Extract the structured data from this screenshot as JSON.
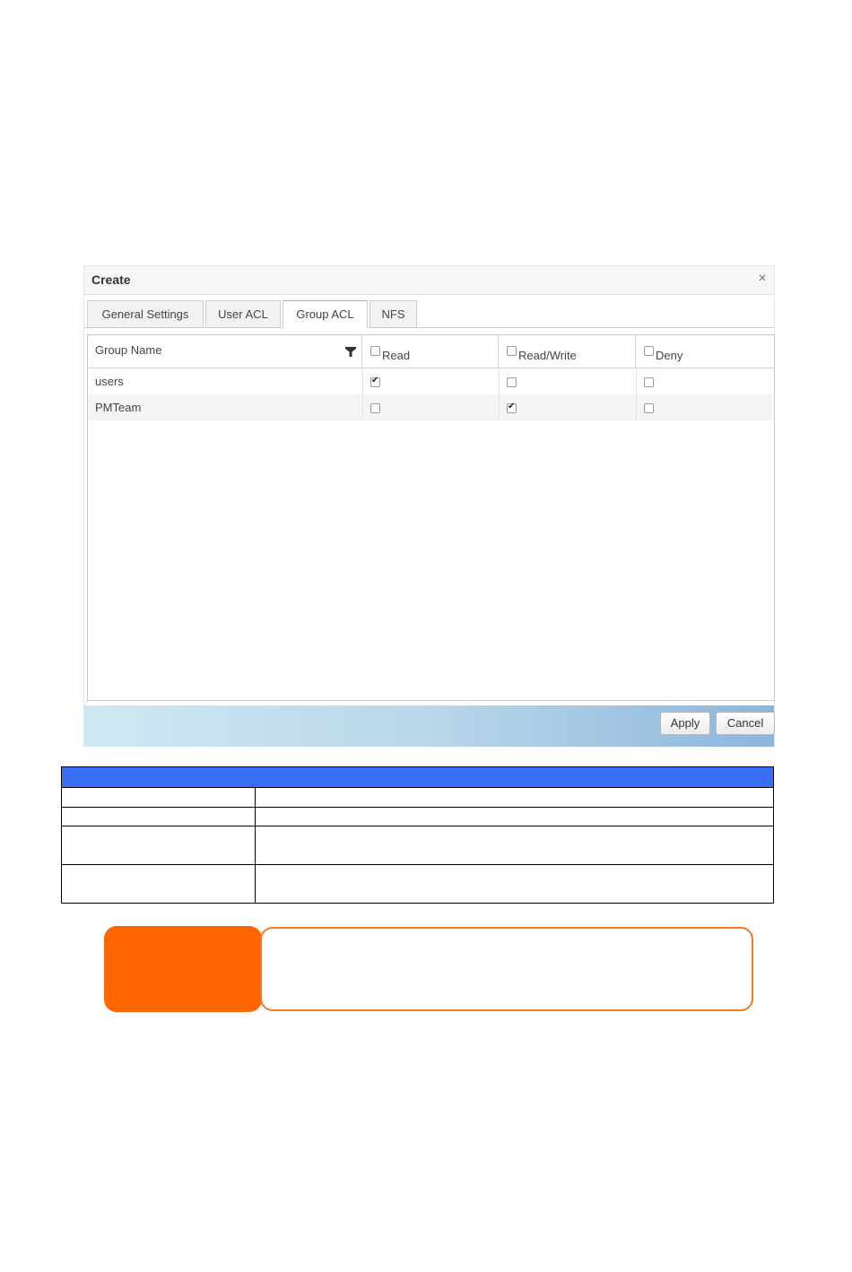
{
  "dialog": {
    "title": "Create",
    "close_glyph": "×",
    "tabs": [
      {
        "label": "General Settings",
        "active": false
      },
      {
        "label": "User ACL",
        "active": false
      },
      {
        "label": "Group ACL",
        "active": true
      },
      {
        "label": "NFS",
        "active": false
      }
    ],
    "grid": {
      "columns": [
        "Group Name",
        "Read",
        "Read/Write",
        "Deny"
      ],
      "filter_icon": "filter-icon",
      "rows": [
        {
          "name": "users",
          "read": true,
          "read_write": false,
          "deny": false
        },
        {
          "name": "PMTeam",
          "read": false,
          "read_write": true,
          "deny": false
        }
      ]
    },
    "buttons": {
      "apply": "Apply",
      "cancel": "Cancel"
    }
  },
  "info_table": {
    "header_color": "#3a6df5",
    "rows": 4
  },
  "note": {
    "accent_color": "#ff6600"
  }
}
